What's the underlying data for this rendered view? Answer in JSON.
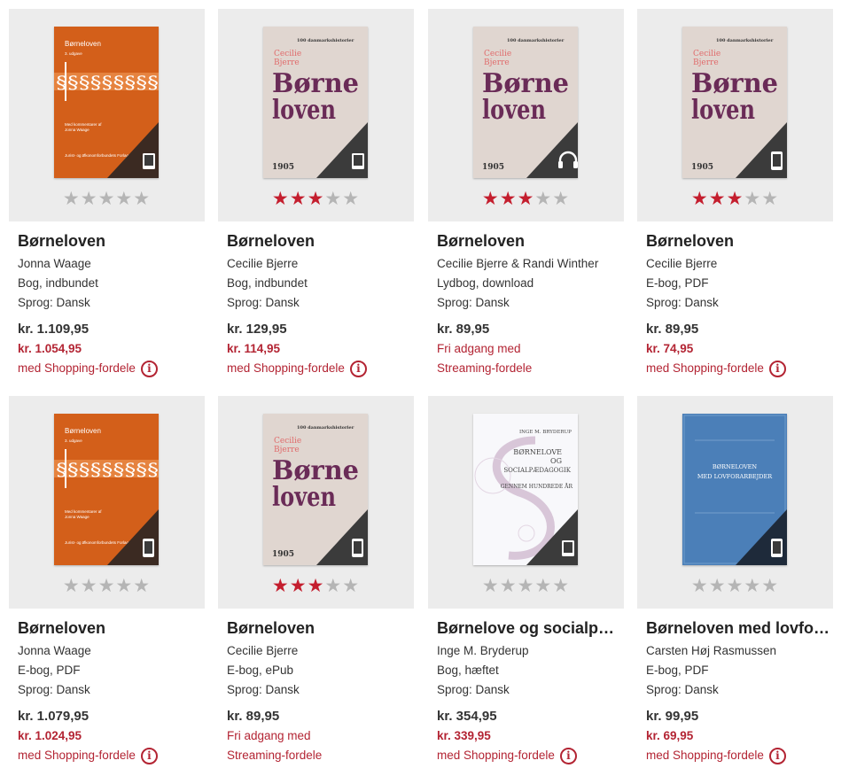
{
  "products": [
    {
      "title": "Børneloven",
      "author": "Jonna Waage",
      "format": "Bog, indbundet",
      "language": "Sprog: Dansk",
      "price": "kr. 1.109,95",
      "member_price": "kr. 1.054,95",
      "benefit_text": "med Shopping-fordele",
      "rating": 0,
      "cover": {
        "style": "orange",
        "format_icon": "book-icon",
        "lines": [
          "Børneloven",
          "3. udgave",
          "Med kommentarer af",
          "Jonna Waage",
          "Jurist- og Økonomforbundets Forlag"
        ]
      }
    },
    {
      "title": "Børneloven",
      "author": "Cecilie Bjerre",
      "format": "Bog, indbundet",
      "language": "Sprog: Dansk",
      "price": "kr. 129,95",
      "member_price": "kr. 114,95",
      "benefit_text": "med Shopping-fordele",
      "rating": 3,
      "cover": {
        "style": "beige",
        "format_icon": "book-icon",
        "lines": [
          "100 danmarkshistorier",
          "Cecilie",
          "Bjerre",
          "Børne",
          "loven",
          "1905"
        ]
      }
    },
    {
      "title": "Børneloven",
      "author": "Cecilie Bjerre & Randi Winther",
      "format": "Lydbog, download",
      "language": "Sprog: Dansk",
      "price": "kr. 89,95",
      "member_price": "Fri adgang med",
      "benefit_text": "Streaming-fordele",
      "rating": 3,
      "cover": {
        "style": "beige",
        "format_icon": "headphones-icon",
        "lines": [
          "100 danmarkshistorier",
          "Cecilie",
          "Bjerre",
          "Børne",
          "loven",
          "1905"
        ]
      }
    },
    {
      "title": "Børneloven",
      "author": "Cecilie Bjerre",
      "format": "E-bog, PDF",
      "language": "Sprog: Dansk",
      "price": "kr. 89,95",
      "member_price": "kr. 74,95",
      "benefit_text": "med Shopping-fordele",
      "rating": 3,
      "cover": {
        "style": "beige",
        "format_icon": "phone-icon",
        "lines": [
          "100 danmarkshistorier",
          "Cecilie",
          "Bjerre",
          "Børne",
          "loven",
          "1905"
        ]
      }
    },
    {
      "title": "Børneloven",
      "author": "Jonna Waage",
      "format": "E-bog, PDF",
      "language": "Sprog: Dansk",
      "price": "kr. 1.079,95",
      "member_price": "kr. 1.024,95",
      "benefit_text": "med Shopping-fordele",
      "rating": 0,
      "cover": {
        "style": "orange",
        "format_icon": "phone-icon",
        "lines": [
          "Børneloven",
          "3. udgave",
          "Med kommentarer af",
          "Jonna Waage",
          "Jurist- og Økonomforbundets Forlag"
        ]
      }
    },
    {
      "title": "Børneloven",
      "author": "Cecilie Bjerre",
      "format": "E-bog, ePub",
      "language": "Sprog: Dansk",
      "price": "kr. 89,95",
      "member_price": "Fri adgang med",
      "benefit_text": "Streaming-fordele",
      "rating": 3,
      "cover": {
        "style": "beige",
        "format_icon": "phone-icon",
        "lines": [
          "100 danmarkshistorier",
          "Cecilie",
          "Bjerre",
          "Børne",
          "loven",
          "1905"
        ]
      }
    },
    {
      "title": "Børnelove og socialp…",
      "author": "Inge M. Bryderup",
      "format": "Bog, hæftet",
      "language": "Sprog: Dansk",
      "price": "kr. 354,95",
      "member_price": "kr. 339,95",
      "benefit_text": "med Shopping-fordele",
      "rating": 0,
      "cover": {
        "style": "white",
        "format_icon": "book-icon",
        "lines": [
          "INGE M. BRYDERUP",
          "BØRNELOVE",
          "OG",
          "SOCIALPÆDAGOGIK",
          "GENNEM HUNDREDE ÅR"
        ]
      }
    },
    {
      "title": "Børneloven med lovfo…",
      "author": "Carsten Høj Rasmussen",
      "format": "E-bog, PDF",
      "language": "Sprog: Dansk",
      "price": "kr. 99,95",
      "member_price": "kr. 69,95",
      "benefit_text": "med Shopping-fordele",
      "rating": 0,
      "cover": {
        "style": "blue",
        "format_icon": "phone-icon",
        "lines": [
          "BØRNELOVEN",
          "MED LOVFORARBEJDER"
        ]
      }
    }
  ],
  "colors": {
    "accent": "#b32433",
    "star_on": "#c41e2e",
    "star_off": "#b5b5b5",
    "card_bg": "#ececec"
  }
}
